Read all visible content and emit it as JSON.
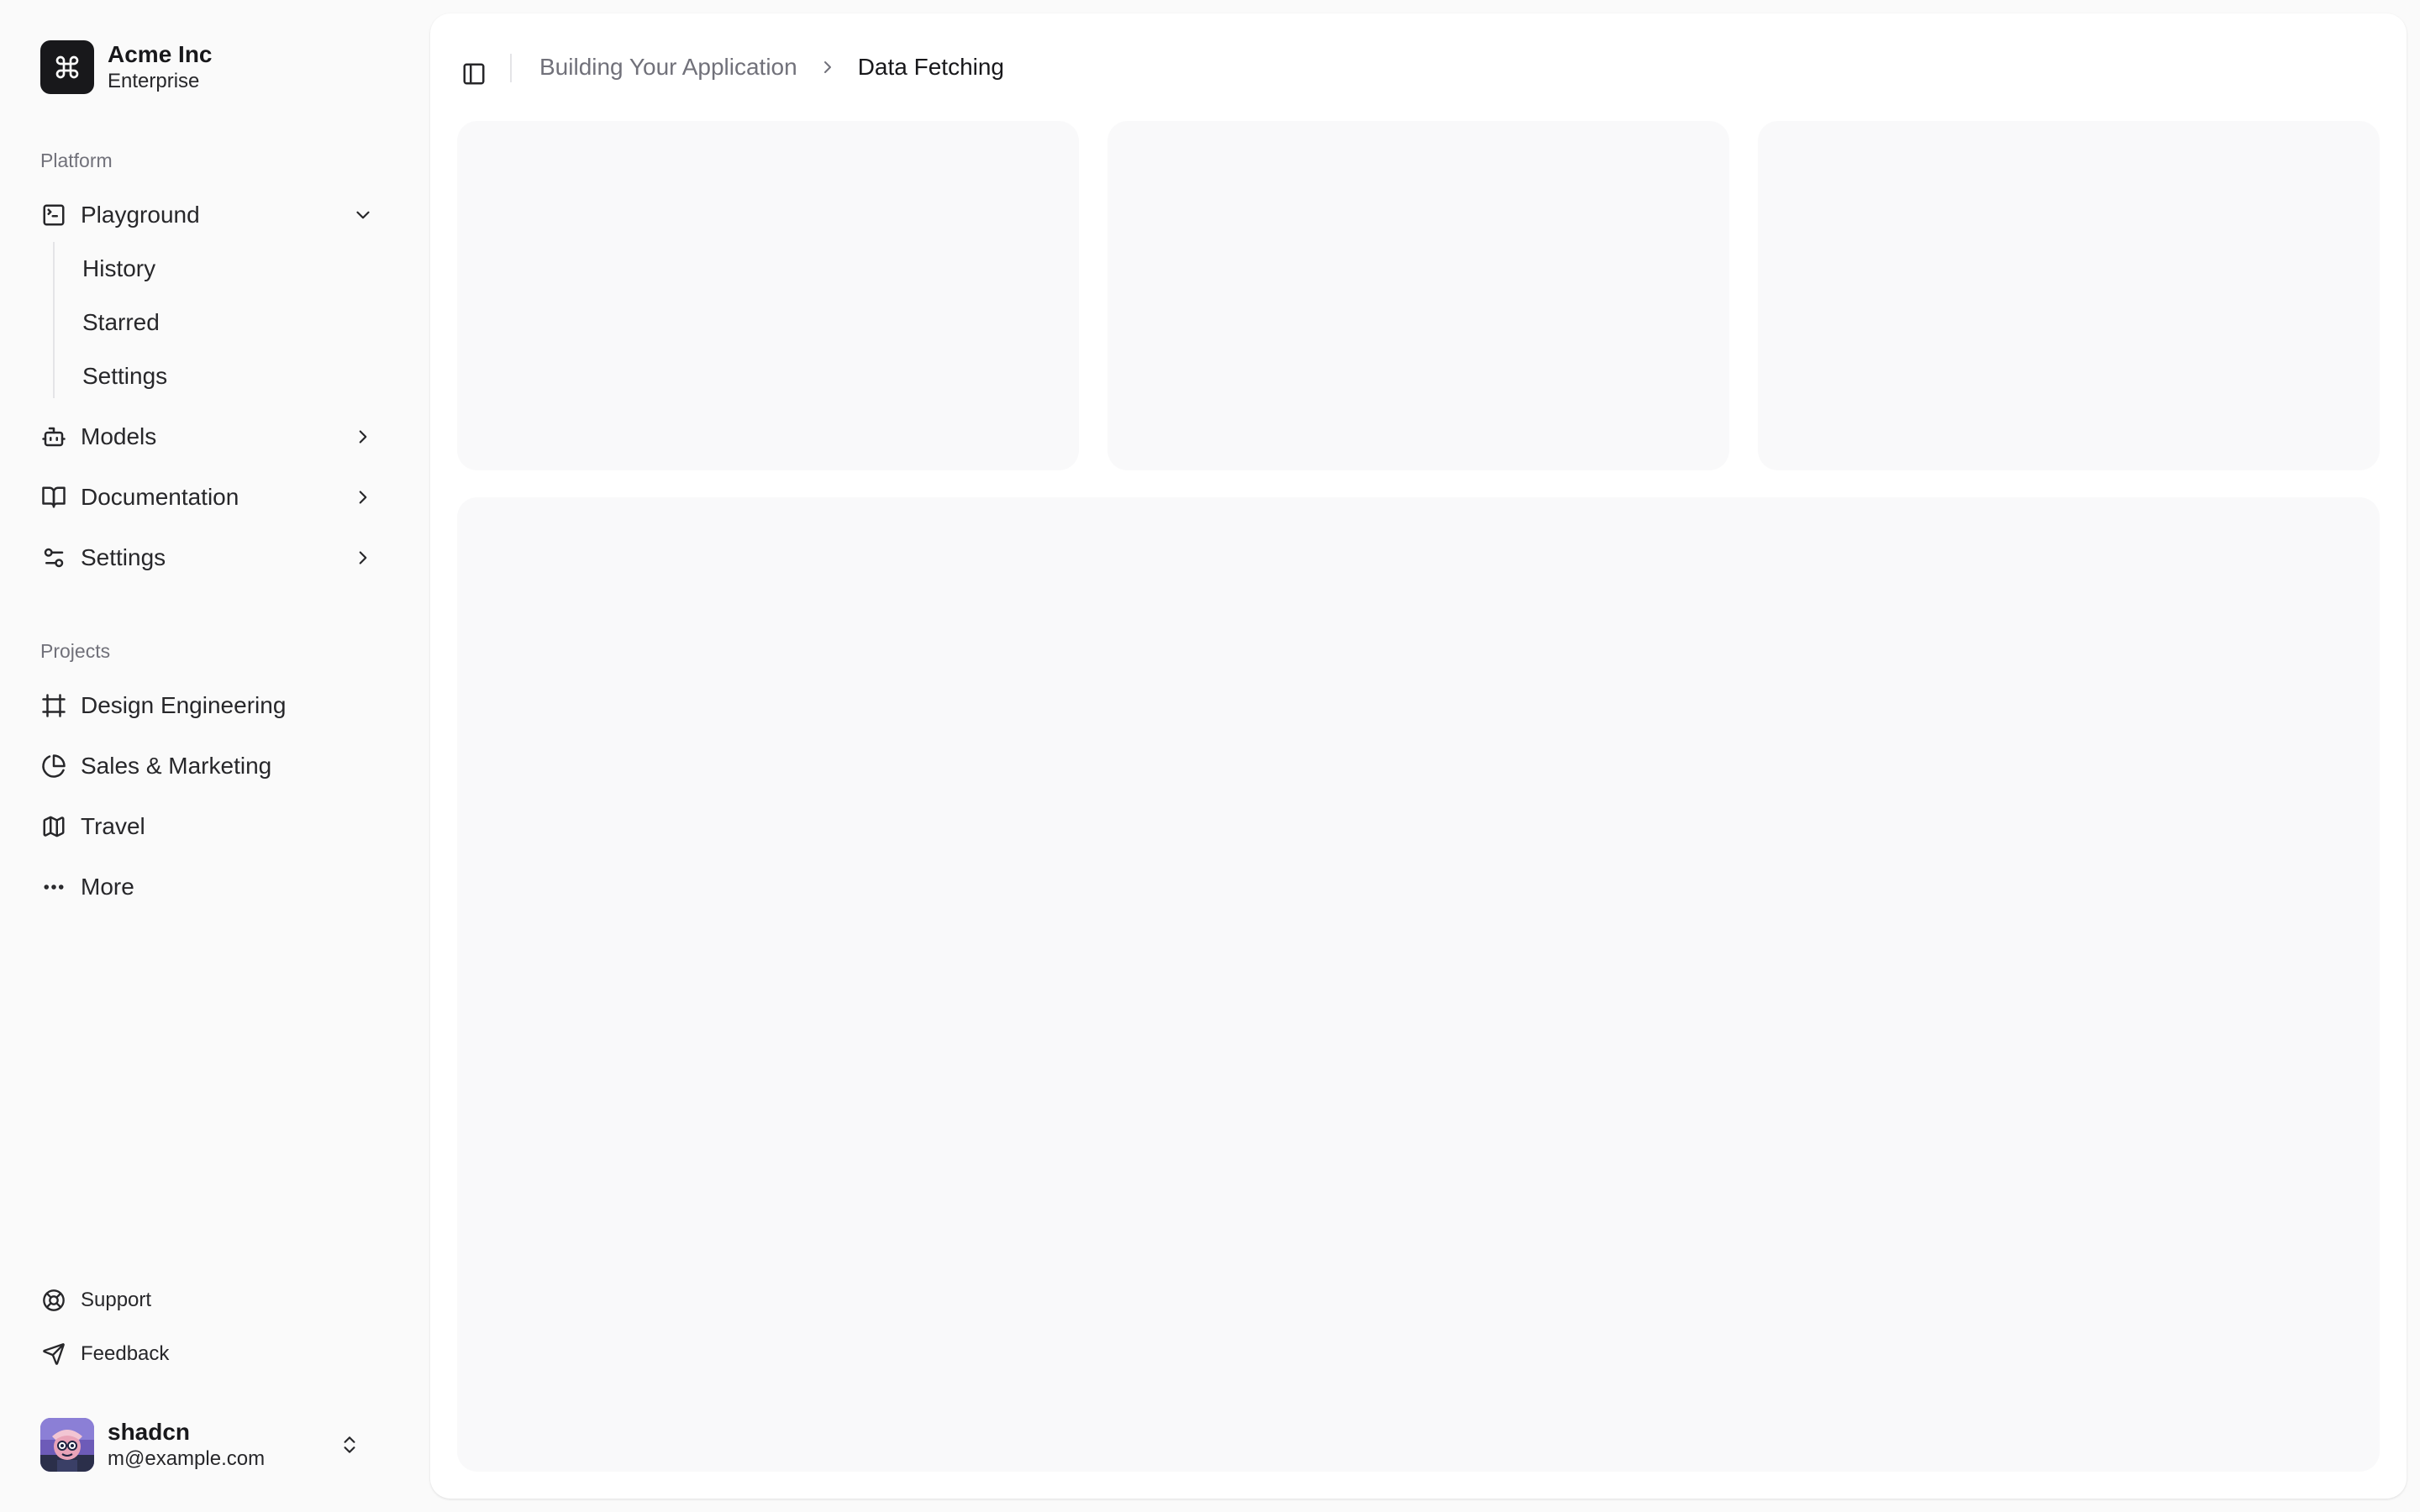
{
  "team": {
    "name": "Acme Inc",
    "plan": "Enterprise",
    "logo_icon": "command-icon"
  },
  "platform": {
    "label": "Platform",
    "items": [
      {
        "label": "Playground",
        "icon": "terminal-square-icon",
        "expanded": true,
        "sub_items": [
          {
            "label": "History"
          },
          {
            "label": "Starred"
          },
          {
            "label": "Settings"
          }
        ]
      },
      {
        "label": "Models",
        "icon": "bot-icon",
        "expanded": false
      },
      {
        "label": "Documentation",
        "icon": "book-open-icon",
        "expanded": false
      },
      {
        "label": "Settings",
        "icon": "settings-sliders-icon",
        "expanded": false
      }
    ]
  },
  "projects": {
    "label": "Projects",
    "items": [
      {
        "label": "Design Engineering",
        "icon": "frame-icon"
      },
      {
        "label": "Sales & Marketing",
        "icon": "pie-chart-icon"
      },
      {
        "label": "Travel",
        "icon": "map-icon"
      },
      {
        "label": "More",
        "icon": "more-horizontal-icon"
      }
    ]
  },
  "secondary": {
    "items": [
      {
        "label": "Support",
        "icon": "life-buoy-icon"
      },
      {
        "label": "Feedback",
        "icon": "send-icon"
      }
    ]
  },
  "user": {
    "name": "shadcn",
    "email": "m@example.com"
  },
  "breadcrumb": {
    "parent": "Building Your Application",
    "current": "Data Fetching"
  },
  "colors": {
    "sidebar_bg": "#fafafa",
    "primary": "#18181b",
    "muted_text": "#71717a",
    "placeholder_bg": "#f4f4f5",
    "border": "#e4e4e7"
  }
}
